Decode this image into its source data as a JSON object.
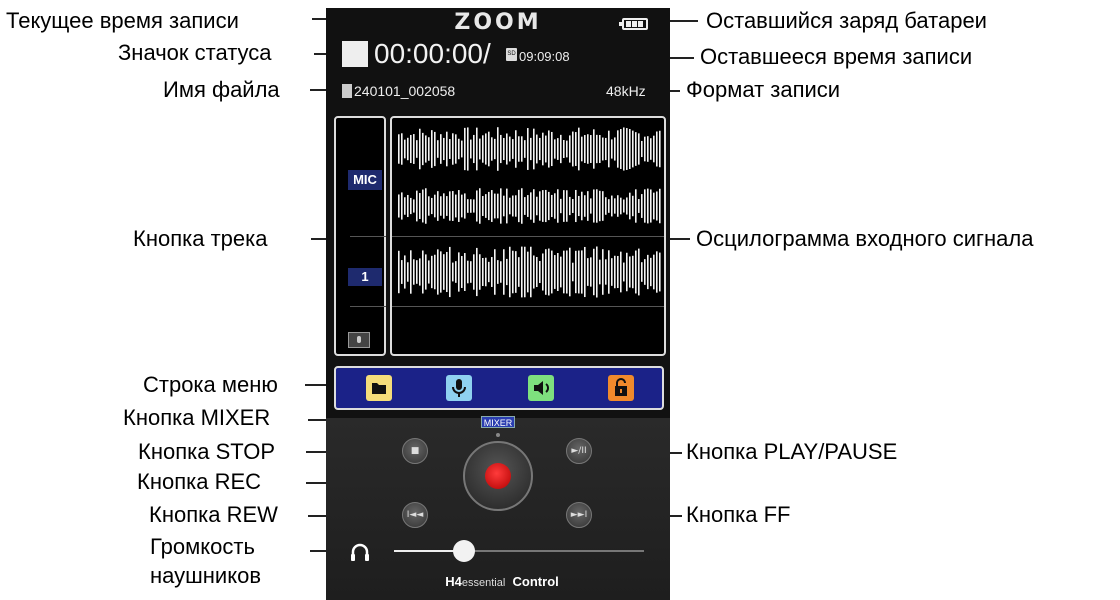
{
  "annotations": {
    "current_time": "Текущее время записи",
    "status_icon": "Значок статуса",
    "file_name": "Имя файла",
    "track_button": "Кнопка трека",
    "menu_bar": "Строка меню",
    "mixer_button": "Кнопка MIXER",
    "stop_button": "Кнопка STOP",
    "rec_button": "Кнопка REC",
    "rew_button": "Кнопка REW",
    "headphone_volume_line1": "Громкость",
    "headphone_volume_line2": "наушников",
    "battery": "Оставшийся заряд батареи",
    "remaining_time": "Оставшееся время записи",
    "record_format": "Формат записи",
    "waveform": "Осцилограмма входного сигнала",
    "play_pause_button": "Кнопка PLAY/PAUSE",
    "ff_button": "Кнопка FF"
  },
  "app": {
    "logo": "ZOOM",
    "current_time": "00:00:00",
    "time_separator": "/",
    "sd_label": "SD",
    "remaining_time": "09:09:08",
    "file_name": "240101_002058",
    "format": "48kHz",
    "tracks": {
      "mic_label": "MIC",
      "track1_label": "1"
    },
    "mixer_label": "MIXER",
    "transport": {
      "stop_glyph": "■",
      "play_pause_glyph": "►/II",
      "rew_glyph": "I◄◄",
      "ff_glyph": "►►I"
    },
    "headphone_volume": 0.28,
    "footer_brand": "H4",
    "footer_essential": "essential",
    "footer_control": "Control",
    "battery_level": 1.0
  },
  "colors": {
    "menu_folder": "#f5dd7a",
    "menu_mic": "#8fd1f0",
    "menu_speaker": "#7ee07e",
    "menu_lock": "#f08a2c",
    "menu_bar_bg": "#1b2288",
    "rec_red": "#e01010"
  },
  "icons": {
    "menu": [
      "folder-icon",
      "microphone-icon",
      "speaker-icon",
      "lock-icon"
    ],
    "headphones": "headphones-icon"
  }
}
